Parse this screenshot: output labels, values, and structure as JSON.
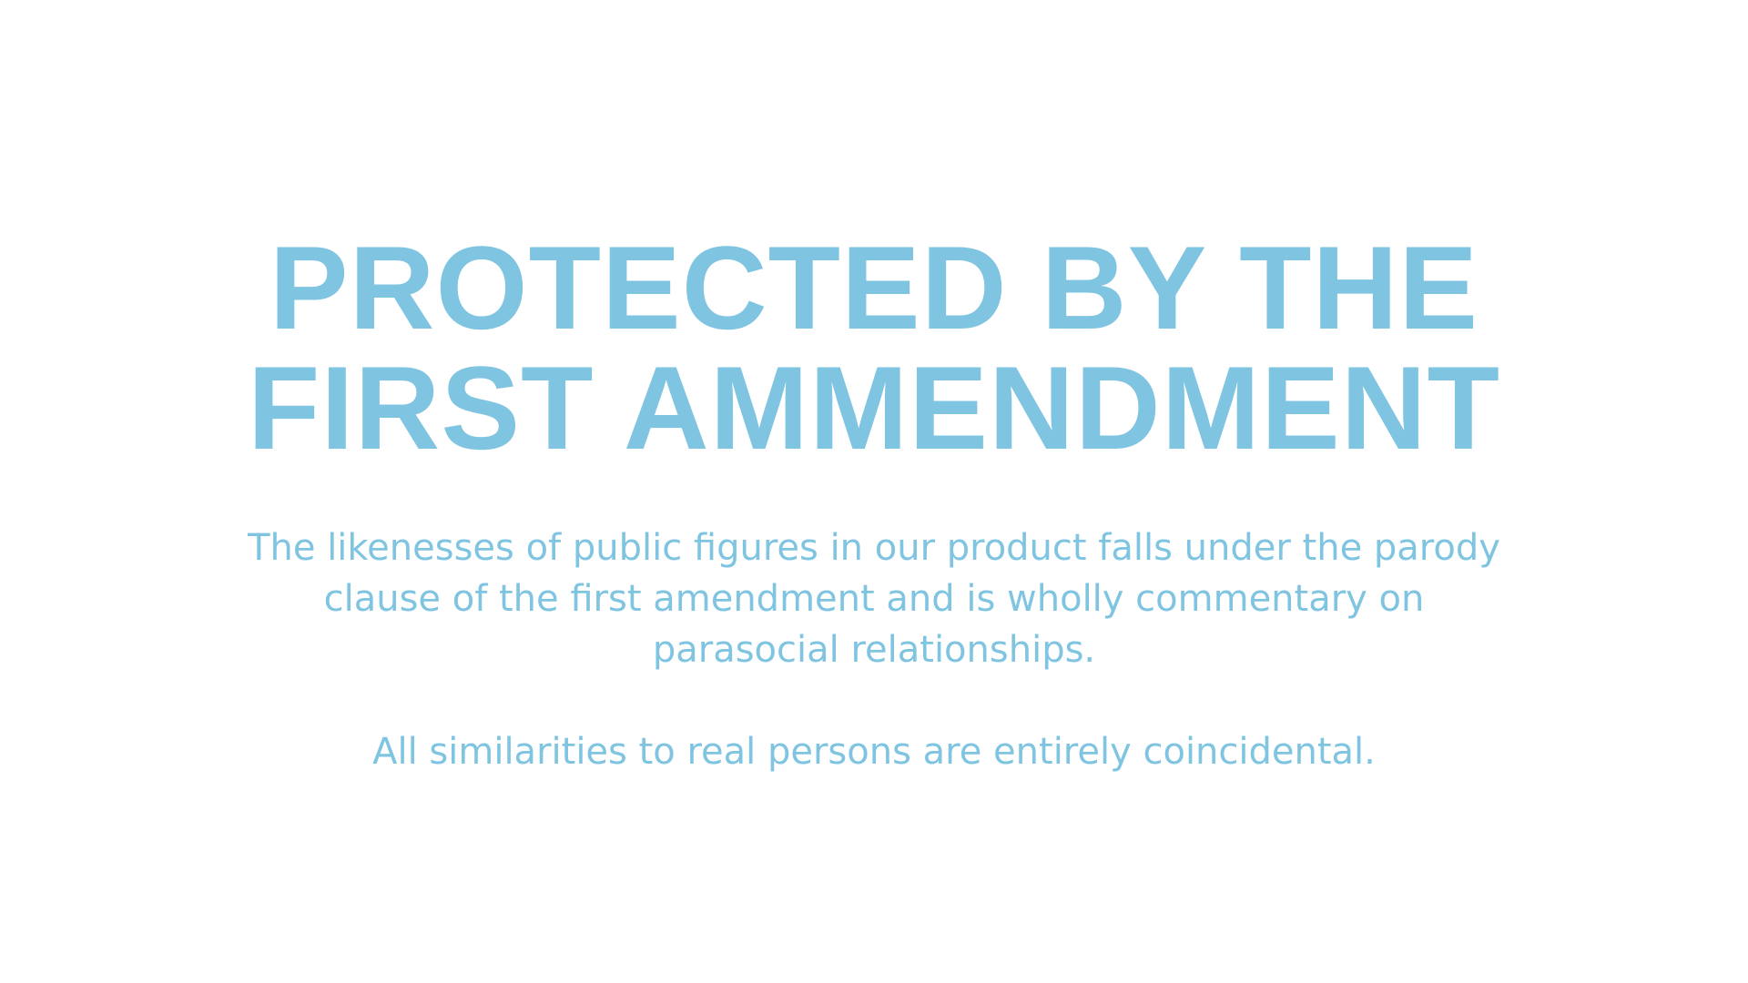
{
  "theme": {
    "accent_color": "#7fc4e1",
    "background_color": "#ffffff"
  },
  "headline": {
    "line1": "PROTECTED BY THE",
    "line2": "FIRST AMMENDMENT"
  },
  "body": {
    "paragraph1": "The likenesses of public figures in our product falls under the parody clause of the first amendment and is wholly commentary on parasocial relationships.",
    "paragraph2": "All similarities to real persons are entirely coincidental."
  }
}
